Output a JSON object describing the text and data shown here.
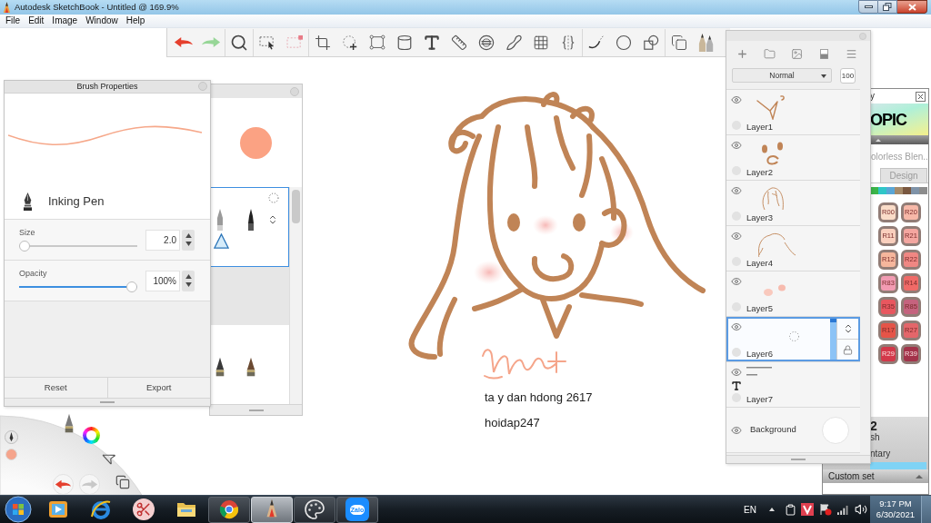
{
  "window": {
    "title": "Autodesk SketchBook - Untitled @ 169.9%"
  },
  "menu": [
    "File",
    "Edit",
    "Image",
    "Window",
    "Help"
  ],
  "brush_properties": {
    "title": "Brush Properties",
    "brush_name": "Inking Pen",
    "sliders": [
      {
        "label": "Size",
        "level": 0,
        "value": "2.0"
      },
      {
        "label": "Opacity",
        "level": 1,
        "value": "100%"
      }
    ],
    "buttons": [
      "Reset",
      "Export"
    ]
  },
  "layers": {
    "blend_mode": "Normal",
    "opacity": "100",
    "items": [
      {
        "name": "Layer1",
        "kind": "paint",
        "selected": false
      },
      {
        "name": "Layer2",
        "kind": "paint",
        "selected": false
      },
      {
        "name": "Layer3",
        "kind": "paint",
        "selected": false
      },
      {
        "name": "Layer4",
        "kind": "paint",
        "selected": false
      },
      {
        "name": "Layer5",
        "kind": "paint",
        "selected": false
      },
      {
        "name": "Layer6",
        "kind": "paint",
        "selected": true
      },
      {
        "name": "Layer7",
        "kind": "text",
        "selected": false
      },
      {
        "name": "Background",
        "kind": "background",
        "selected": false
      }
    ]
  },
  "copic_library": {
    "title": "y",
    "logo": "OPIC",
    "set_name": "olorless Blen..",
    "tabs": [
      {
        "label": "Design",
        "selected": false
      }
    ],
    "swatches": [
      {
        "color": "#3cb54a"
      },
      {
        "color": "#2fc6c8"
      },
      {
        "color": "#5aa6d6"
      },
      {
        "color": "#a58a6a"
      },
      {
        "color": "#7a5840"
      },
      {
        "color": "#7f93a8"
      },
      {
        "color": "#8c8c8c"
      }
    ],
    "markers": [
      {
        "label": "R00",
        "color": "#fadcc8"
      },
      {
        "label": "R20",
        "color": "#f7b8a8"
      },
      {
        "label": "R11",
        "color": "#f9cfbd"
      },
      {
        "label": "R21",
        "color": "#f4a6a0"
      },
      {
        "label": "R12",
        "color": "#f6b69c"
      },
      {
        "label": "R22",
        "color": "#f08783"
      },
      {
        "label": "R83",
        "color": "#f29bb2"
      },
      {
        "label": "R14",
        "color": "#f06a67"
      },
      {
        "label": "R35",
        "color": "#e8575f"
      },
      {
        "label": "R85",
        "color": "#c5637e"
      },
      {
        "label": "R17",
        "color": "#e55448"
      },
      {
        "label": "R27",
        "color": "#e4666a"
      },
      {
        "label": "R29",
        "color": "#d3384a"
      },
      {
        "label": "R39",
        "color": "#a3334a"
      }
    ],
    "footer": {
      "number": "2",
      "line_1": "sh",
      "line_2": "ntary"
    },
    "custom_set": "Custom set"
  },
  "canvas": {
    "texts": [
      "ta y dan hdong 2617",
      "hoidap247"
    ]
  },
  "taskbar": {
    "apps": [
      {
        "running": false,
        "selected": false
      },
      {
        "running": false,
        "selected": false
      },
      {
        "running": false,
        "selected": false
      },
      {
        "running": false,
        "selected": false
      },
      {
        "running": true,
        "selected": false
      },
      {
        "running": true,
        "selected": true
      },
      {
        "running": true,
        "selected": false
      },
      {
        "running": true,
        "selected": false,
        "label": "Zalo"
      }
    ],
    "language": "EN",
    "time": "9:17 PM",
    "date": "6/30/2021"
  }
}
